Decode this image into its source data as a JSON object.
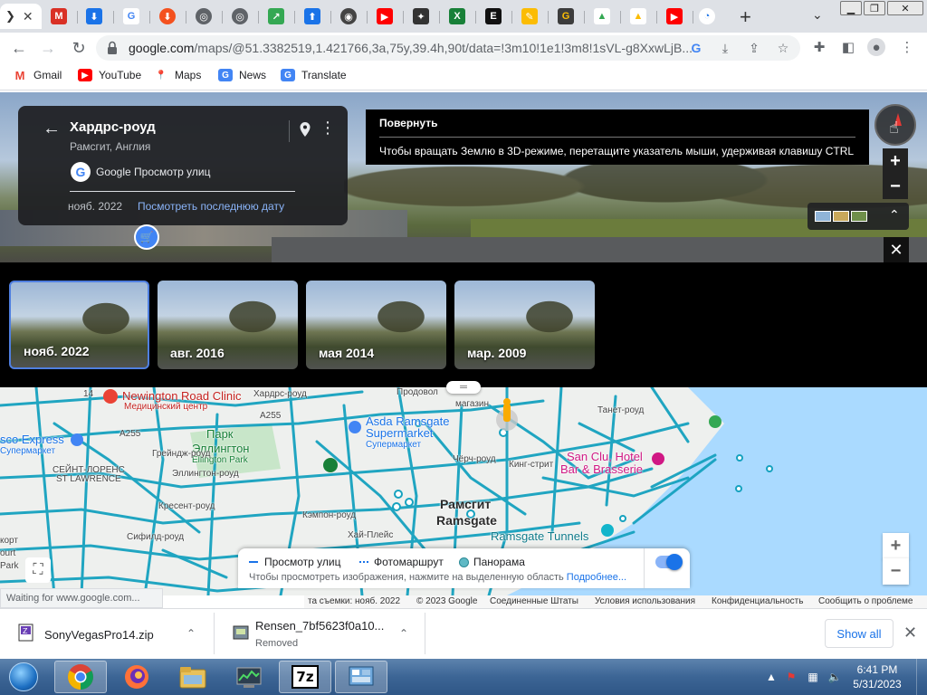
{
  "browser": {
    "active_tab_glyph": "❯",
    "url_host": "google.com",
    "url_rest": "/maps/@51.3382519,1.421766,3a,75y,39.4h,90t/data=!3m10!1e1!3m8!1sVL-g8XxwLjB...",
    "status_text": "Waiting for www.google.com..."
  },
  "bookmarks": [
    {
      "label": "Gmail",
      "icon": "gmail-icon",
      "color": "#ea4335",
      "glyph": "M"
    },
    {
      "label": "YouTube",
      "icon": "youtube-icon",
      "color": "#ff0000",
      "glyph": "▶"
    },
    {
      "label": "Maps",
      "icon": "maps-icon",
      "color": "#34a853",
      "glyph": "📍"
    },
    {
      "label": "News",
      "icon": "news-icon",
      "color": "#4285f4",
      "glyph": "G"
    },
    {
      "label": "Translate",
      "icon": "translate-icon",
      "color": "#4285f4",
      "glyph": "G"
    }
  ],
  "infocard": {
    "title": "Хардрс-роуд",
    "subtitle": "Рамсгит, Англия",
    "provider": "Google Просмотр улиц",
    "date": "нояб. 2022",
    "latest_link": "Посмотреть последнюю дату"
  },
  "tooltip": {
    "title": "Повернуть",
    "text": "Чтобы вращать Землю в 3D-режиме, перетащите указатель мыши, удерживая клавишу CTRL"
  },
  "timeline": [
    {
      "label": "нояб. 2022",
      "selected": true
    },
    {
      "label": "авг. 2016",
      "selected": false
    },
    {
      "label": "мая 2014",
      "selected": false
    },
    {
      "label": "мар. 2009",
      "selected": false
    }
  ],
  "map": {
    "labels": {
      "clinic": "Newington Road Clinic",
      "clinic_sub": "Медицинский центр",
      "tesco": "sco Express",
      "tesco_sub": "Супермаркет",
      "park": "Парк",
      "park2": "Эллингтон",
      "park_en": "Ellington Park",
      "asda": "Asda Ramsgate",
      "asda2": "Supermarket",
      "asda_sub": "Супермаркет",
      "stlaw": "СЕЙНТ-ЛОРЕНС",
      "stlaw_en": "ST LAWRENCE",
      "ramsgate_ru": "Рамсгит",
      "ramsgate": "Ramsgate",
      "sanclu": "San Clu, Hotel",
      "sanclu2": "Bar & Brasserie",
      "tunnels": "Ramsgate Tunnels",
      "food": "Продовол",
      "food2": "магазин",
      "a255": "A255",
      "a255b": "A255",
      "road1": "Хардрс-роуд",
      "road2": "Эллингтон-роуд",
      "road3": "Кресент-роуд",
      "road4": "Сифилд-роуд",
      "road5": "Грейндж-роуд",
      "road6": "Чёрч-роуд",
      "road7": "Кинг-стрит",
      "road8": "Танет-роуд",
      "road9": "Кэмпон-роуд",
      "road10": "Хай-Плейс",
      "left1": "корт",
      "left2": "ourt",
      "left3": "Park",
      "n14": "14"
    },
    "legend": {
      "street_view": "Просмотр улиц",
      "photo_route": "Фотомаршрут",
      "panorama": "Панорама",
      "hint": "Чтобы просмотреть изображения, нажмите на выделенную область",
      "more": "Подробнее..."
    },
    "footer": [
      "та съемки: нояб. 2022",
      "© 2023 Google",
      "Соединенные Штаты",
      "Условия использования",
      "Конфиденциальность",
      "Сообщить о проблеме"
    ]
  },
  "downloads": [
    {
      "name": "SonyVegasPro14.zip",
      "sub": ""
    },
    {
      "name": "Rensen_7bf5623f0a10...",
      "sub": "Removed"
    }
  ],
  "shelf": {
    "show_all": "Show all"
  },
  "clock": {
    "time": "6:41 PM",
    "date": "5/31/2023"
  },
  "taskbar": {
    "sevenzip_label": "7z"
  }
}
